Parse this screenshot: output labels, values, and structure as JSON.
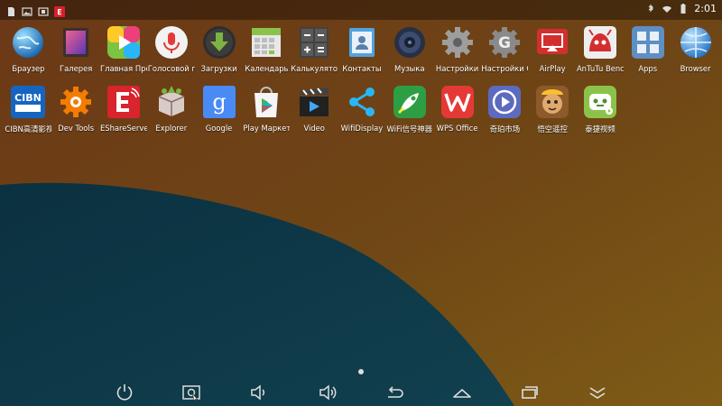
{
  "status_bar": {
    "time": "2:01",
    "left_icons": [
      "sd-card-icon",
      "image-icon",
      "screenshot-icon",
      "eshare-notification-icon"
    ],
    "right_icons": [
      "bluetooth-icon",
      "wifi-icon",
      "battery-icon"
    ]
  },
  "apps": [
    {
      "id": "browser-ru",
      "label": "Браузер",
      "icon": "globe-icon"
    },
    {
      "id": "gallery",
      "label": "Галерея",
      "icon": "gallery-icon"
    },
    {
      "id": "main-screen",
      "label": "Главная Пресс",
      "icon": "play-icon"
    },
    {
      "id": "voice-search",
      "label": "Голосовой поиск",
      "icon": "microphone-icon"
    },
    {
      "id": "downloads",
      "label": "Загрузки",
      "icon": "download-icon"
    },
    {
      "id": "calendar",
      "label": "Календарь",
      "icon": "calendar-icon"
    },
    {
      "id": "calculator",
      "label": "Калькулятор",
      "icon": "calculator-icon"
    },
    {
      "id": "contacts",
      "label": "Контакты",
      "icon": "contacts-icon"
    },
    {
      "id": "music",
      "label": "Музыка",
      "icon": "speaker-icon"
    },
    {
      "id": "settings",
      "label": "Настройки",
      "icon": "gear-icon"
    },
    {
      "id": "google-settings",
      "label": "Настройки Google",
      "icon": "google-gear-icon"
    },
    {
      "id": "airplay",
      "label": "AirPlay",
      "icon": "airplay-icon"
    },
    {
      "id": "antutu",
      "label": "AnTuTu Benchmark",
      "icon": "antutu-icon"
    },
    {
      "id": "apps",
      "label": "Apps",
      "icon": "apps-grid-icon"
    },
    {
      "id": "browser",
      "label": "Browser",
      "icon": "globe-icon"
    },
    {
      "id": "cibn",
      "label": "CIBN高清影视",
      "icon": "cibn-icon"
    },
    {
      "id": "dev-tools",
      "label": "Dev Tools",
      "icon": "dev-tools-gear-icon"
    },
    {
      "id": "eshareserver",
      "label": "EShareServer",
      "icon": "eshare-icon"
    },
    {
      "id": "explorer",
      "label": "Explorer",
      "icon": "box-icon"
    },
    {
      "id": "google",
      "label": "Google",
      "icon": "google-g-icon"
    },
    {
      "id": "play-market",
      "label": "Play Маркет",
      "icon": "play-store-icon"
    },
    {
      "id": "video",
      "label": "Video",
      "icon": "clapperboard-icon"
    },
    {
      "id": "wifidisplay",
      "label": "WifiDisplay",
      "icon": "share-icon"
    },
    {
      "id": "wifi-booster",
      "label": "WiFi信号神器",
      "icon": "rocket-icon"
    },
    {
      "id": "wps-office",
      "label": "WPS Office",
      "icon": "wps-icon"
    },
    {
      "id": "qiyi-market",
      "label": "奇珀市场",
      "icon": "market-play-icon"
    },
    {
      "id": "wukong",
      "label": "悟空遥控",
      "icon": "monkey-icon"
    },
    {
      "id": "tiejie-video",
      "label": "泰捷视频",
      "icon": "robot-tv-icon"
    }
  ],
  "colors": {
    "wallpaper_brown": "#6a3a16",
    "wallpaper_orange": "#7a5a15",
    "wallpaper_teal": "#0f3b4c",
    "status_bar": "#000000"
  },
  "nav_bar": [
    {
      "id": "power",
      "icon": "power-icon"
    },
    {
      "id": "screenshot",
      "icon": "screenshot-icon"
    },
    {
      "id": "volume-down",
      "icon": "volume-down-icon"
    },
    {
      "id": "volume-up",
      "icon": "volume-up-icon"
    },
    {
      "id": "back",
      "icon": "back-icon"
    },
    {
      "id": "home",
      "icon": "home-icon"
    },
    {
      "id": "recents",
      "icon": "recents-icon"
    },
    {
      "id": "hide-bar",
      "icon": "chevron-down-double-icon"
    }
  ]
}
